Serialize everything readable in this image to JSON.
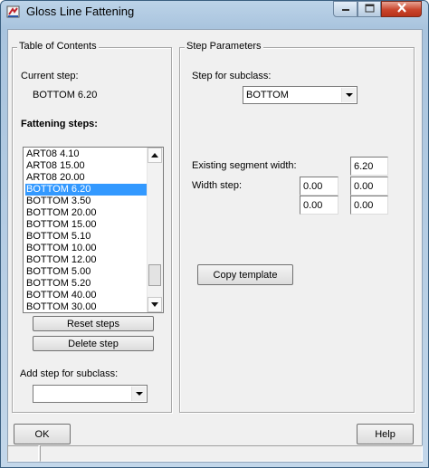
{
  "window": {
    "title": "Gloss Line Fattening",
    "icons": {
      "app": "app-icon",
      "minimize": "minimize-icon",
      "maximize": "maximize-icon",
      "close": "close-icon"
    }
  },
  "toc": {
    "group_label": "Table of Contents",
    "current_step_label": "Current step:",
    "current_step_value": "BOTTOM 6.20",
    "fattening_label": "Fattening steps:",
    "steps": [
      "ART08 4.10",
      "ART08 15.00",
      "ART08 20.00",
      "BOTTOM 6.20",
      "BOTTOM 3.50",
      "BOTTOM 20.00",
      "BOTTOM 15.00",
      "BOTTOM 5.10",
      "BOTTOM 10.00",
      "BOTTOM 12.00",
      "BOTTOM 5.00",
      "BOTTOM 5.20",
      "BOTTOM 40.00",
      "BOTTOM 30.00"
    ],
    "selected_step": "BOTTOM 6.20",
    "reset_label": "Reset steps",
    "delete_label": "Delete step",
    "add_step_label": "Add step for subclass:",
    "add_step_value": ""
  },
  "params": {
    "group_label": "Step Parameters",
    "subclass_label": "Step for subclass:",
    "subclass_value": "BOTTOM",
    "existing_width_label": "Existing segment width:",
    "existing_width_value": "6.20",
    "width_step_label": "Width step:",
    "width_step_values": [
      "0.00",
      "0.00",
      "0.00",
      "0.00"
    ],
    "copy_template_label": "Copy template"
  },
  "footer": {
    "ok_label": "OK",
    "help_label": "Help"
  },
  "colors": {
    "selection": "#3399ff",
    "close_button": "#c9452c",
    "frame": "#a9c4de"
  }
}
